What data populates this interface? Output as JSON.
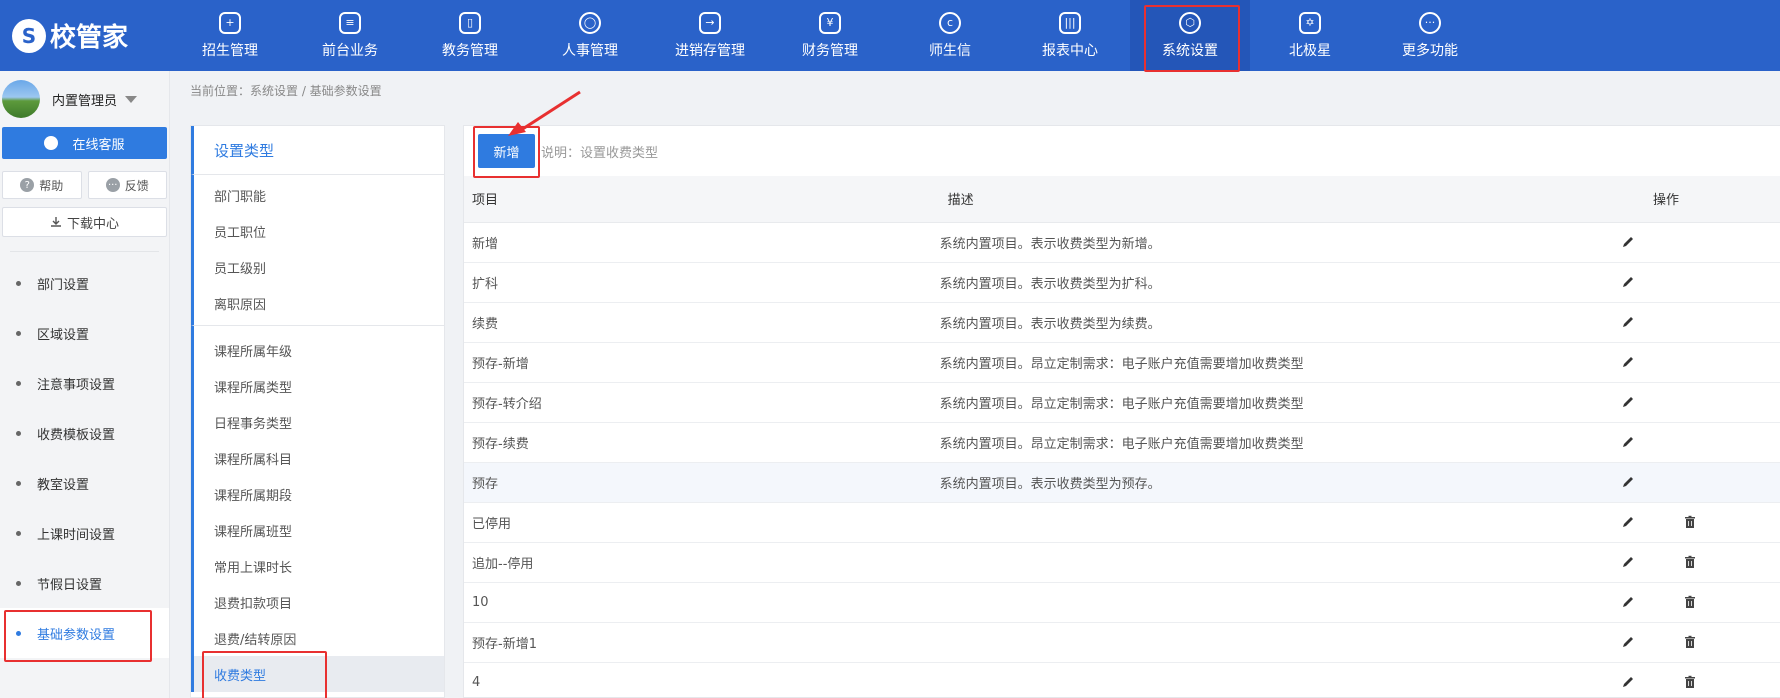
{
  "brand": {
    "logo_text": "校管家",
    "logo_mark": "S"
  },
  "topnav": [
    {
      "label": "招生管理",
      "icon": "user-add-icon"
    },
    {
      "label": "前台业务",
      "icon": "desk-icon"
    },
    {
      "label": "教务管理",
      "icon": "book-icon"
    },
    {
      "label": "人事管理",
      "icon": "person-icon"
    },
    {
      "label": "进销存管理",
      "icon": "inventory-icon"
    },
    {
      "label": "财务管理",
      "icon": "finance-icon"
    },
    {
      "label": "师生信",
      "icon": "chat-icon"
    },
    {
      "label": "报表中心",
      "icon": "report-icon"
    },
    {
      "label": "系统设置",
      "icon": "gear-icon",
      "active": true
    },
    {
      "label": "北极星",
      "icon": "star-icon"
    },
    {
      "label": "更多功能",
      "icon": "more-icon"
    }
  ],
  "sidebar": {
    "user_name": "内置管理员",
    "service_label": "在线客服",
    "help_label": "帮助",
    "feedback_label": "反馈",
    "download_label": "下载中心",
    "items": [
      {
        "label": "部门设置"
      },
      {
        "label": "区域设置"
      },
      {
        "label": "注意事项设置"
      },
      {
        "label": "收费模板设置"
      },
      {
        "label": "教室设置"
      },
      {
        "label": "上课时间设置"
      },
      {
        "label": "节假日设置"
      },
      {
        "label": "基础参数设置",
        "active": true
      }
    ]
  },
  "breadcrumb": "当前位置：系统设置 / 基础参数设置",
  "type_panel": {
    "title": "设置类型",
    "group1": [
      "部门职能",
      "员工职位",
      "员工级别",
      "离职原因"
    ],
    "group2": [
      "课程所属年级",
      "课程所属类型",
      "日程事务类型",
      "课程所属科目",
      "课程所属期段",
      "课程所属班型",
      "常用上课时长",
      "退费扣款项目",
      "退费/结转原因",
      "收费类型"
    ],
    "active": "收费类型"
  },
  "toolbar": {
    "add_label": "新增",
    "note": "说明：设置收费类型"
  },
  "table": {
    "headers": {
      "item": "项目",
      "desc": "描述",
      "ops": "操作"
    },
    "rows": [
      {
        "item": "新增",
        "desc": "系统内置项目。表示收费类型为新增。",
        "deletable": false
      },
      {
        "item": "扩科",
        "desc": "系统内置项目。表示收费类型为扩科。",
        "deletable": false
      },
      {
        "item": "续费",
        "desc": "系统内置项目。表示收费类型为续费。",
        "deletable": false
      },
      {
        "item": "预存-新增",
        "desc": "系统内置项目。昂立定制需求：电子账户充值需要增加收费类型",
        "deletable": false
      },
      {
        "item": "预存-转介绍",
        "desc": "系统内置项目。昂立定制需求：电子账户充值需要增加收费类型",
        "deletable": false
      },
      {
        "item": "预存-续费",
        "desc": "系统内置项目。昂立定制需求：电子账户充值需要增加收费类型",
        "deletable": false
      },
      {
        "item": "预存",
        "desc": "系统内置项目。表示收费类型为预存。",
        "deletable": false,
        "highlight": true
      },
      {
        "item": "已停用",
        "desc": "",
        "deletable": true
      },
      {
        "item": "追加--停用",
        "desc": "",
        "deletable": true
      },
      {
        "item": "10",
        "desc": "",
        "deletable": true
      },
      {
        "item": "预存-新增1",
        "desc": "",
        "deletable": true
      },
      {
        "item": "4",
        "desc": "",
        "deletable": true
      }
    ]
  },
  "colors": {
    "nav_bg": "#2a62c9",
    "accent": "#2f7be0",
    "annotation": "#e83030"
  }
}
